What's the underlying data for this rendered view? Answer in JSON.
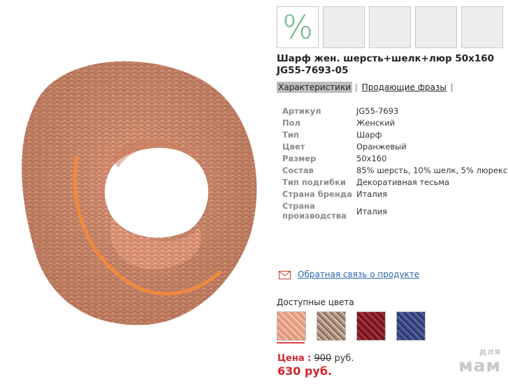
{
  "thumbnails": {
    "badge_symbol": "%",
    "count": 5
  },
  "product": {
    "title_line1": "Шарф жен. шерсть+шелк+люр 50х160",
    "title_line2": "JG55-7693-05"
  },
  "tabs": [
    {
      "label": "Характеристики",
      "active": true
    },
    {
      "label": "Продающие фразы",
      "active": false
    }
  ],
  "characteristics": [
    {
      "label": "Артикул",
      "value": "JG55-7693"
    },
    {
      "label": "Пол",
      "value": "Женский"
    },
    {
      "label": "Тип",
      "value": "Шарф"
    },
    {
      "label": "Цвет",
      "value": "Оранжевый"
    },
    {
      "label": "Размер",
      "value": "50x160"
    },
    {
      "label": "Состав",
      "value": "85% шерсть, 10% шелк, 5% люрекс"
    },
    {
      "label": "Тип подгибки",
      "value": "Декоративная тесьма"
    },
    {
      "label": "Страна бренда",
      "value": "Италия"
    },
    {
      "label": "Страна производства",
      "value": "Италия"
    }
  ],
  "feedback": {
    "icon": "mail-icon",
    "link": "Обратная связь о продукте"
  },
  "colors": {
    "title": "Доступные цвета",
    "swatches": [
      {
        "name": "orange",
        "color": "#e8a58a"
      },
      {
        "name": "beige",
        "color": "#b0927c"
      },
      {
        "name": "burgundy",
        "color": "#8a1e28"
      },
      {
        "name": "navy",
        "color": "#3c4a86"
      }
    ],
    "selected_index": 0
  },
  "price": {
    "label": "Цена :",
    "old_value": "900",
    "currency": "руб.",
    "new_price": "630 руб."
  },
  "watermark": {
    "line1": "для",
    "line2": "мам"
  },
  "colors_accent": {
    "price_red": "#d1252b",
    "link_blue": "#2a66b0",
    "badge_green": "#66b88a"
  }
}
